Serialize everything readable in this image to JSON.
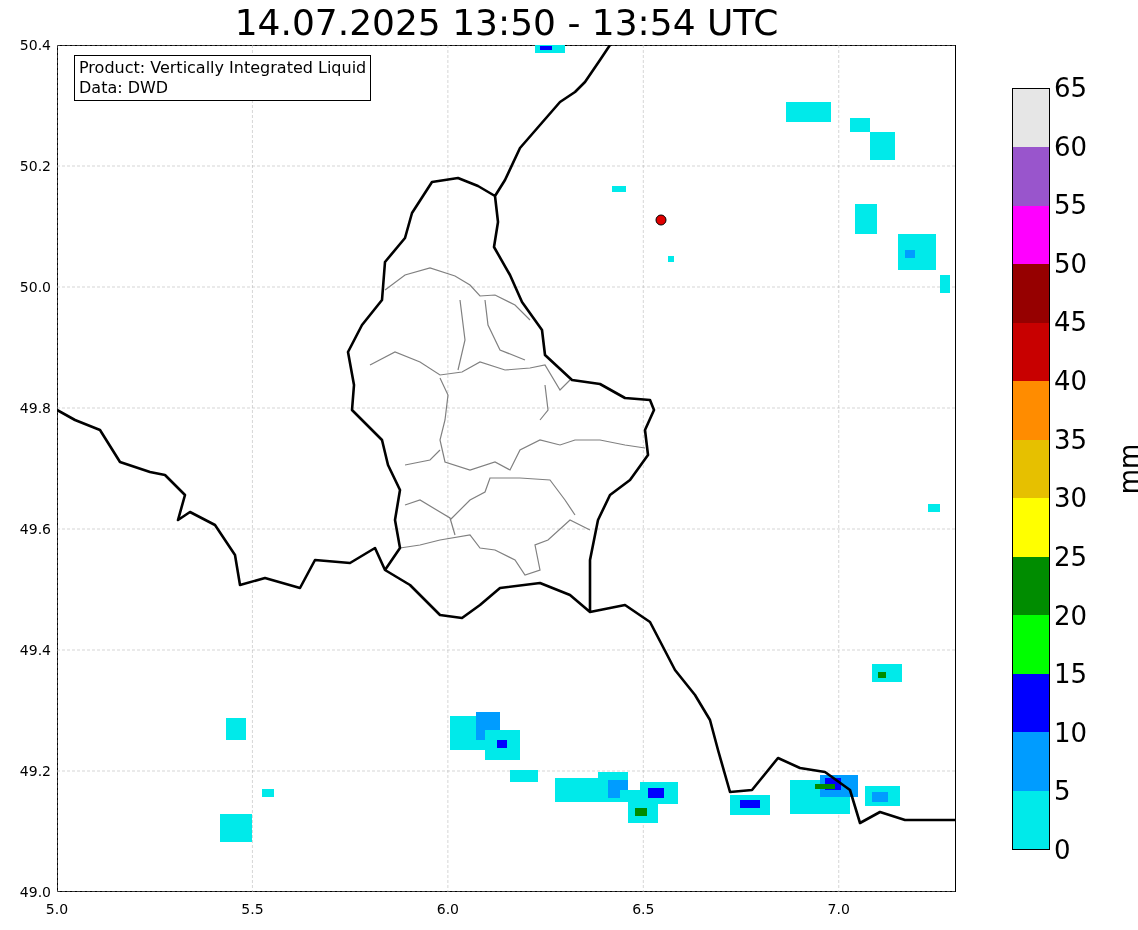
{
  "title": "14.07.2025 13:50 - 13:54 UTC",
  "info_box": [
    "Product: Vertically Integrated Liquid",
    "Data: DWD"
  ],
  "x_ticks": [
    "5.0",
    "5.5",
    "6.0",
    "6.5",
    "7.0"
  ],
  "y_ticks": [
    "50.4",
    "50.2",
    "50.0",
    "49.8",
    "49.6",
    "49.4",
    "49.2",
    "49.0"
  ],
  "colorbar": {
    "label": "mm",
    "segments": [
      {
        "color": "#00eaea"
      },
      {
        "color": "#009cff"
      },
      {
        "color": "#0000ff"
      },
      {
        "color": "#00ff00"
      },
      {
        "color": "#008c00"
      },
      {
        "color": "#ffff00"
      },
      {
        "color": "#e6c000"
      },
      {
        "color": "#ff8c00"
      },
      {
        "color": "#c80000"
      },
      {
        "color": "#960000"
      },
      {
        "color": "#ff00ff"
      },
      {
        "color": "#9955cc"
      },
      {
        "color": "#e6e6e6"
      }
    ],
    "ticks": [
      "65",
      "60",
      "55",
      "50",
      "45",
      "40",
      "35",
      "30",
      "25",
      "20",
      "15",
      "10",
      "5",
      "0"
    ]
  }
}
